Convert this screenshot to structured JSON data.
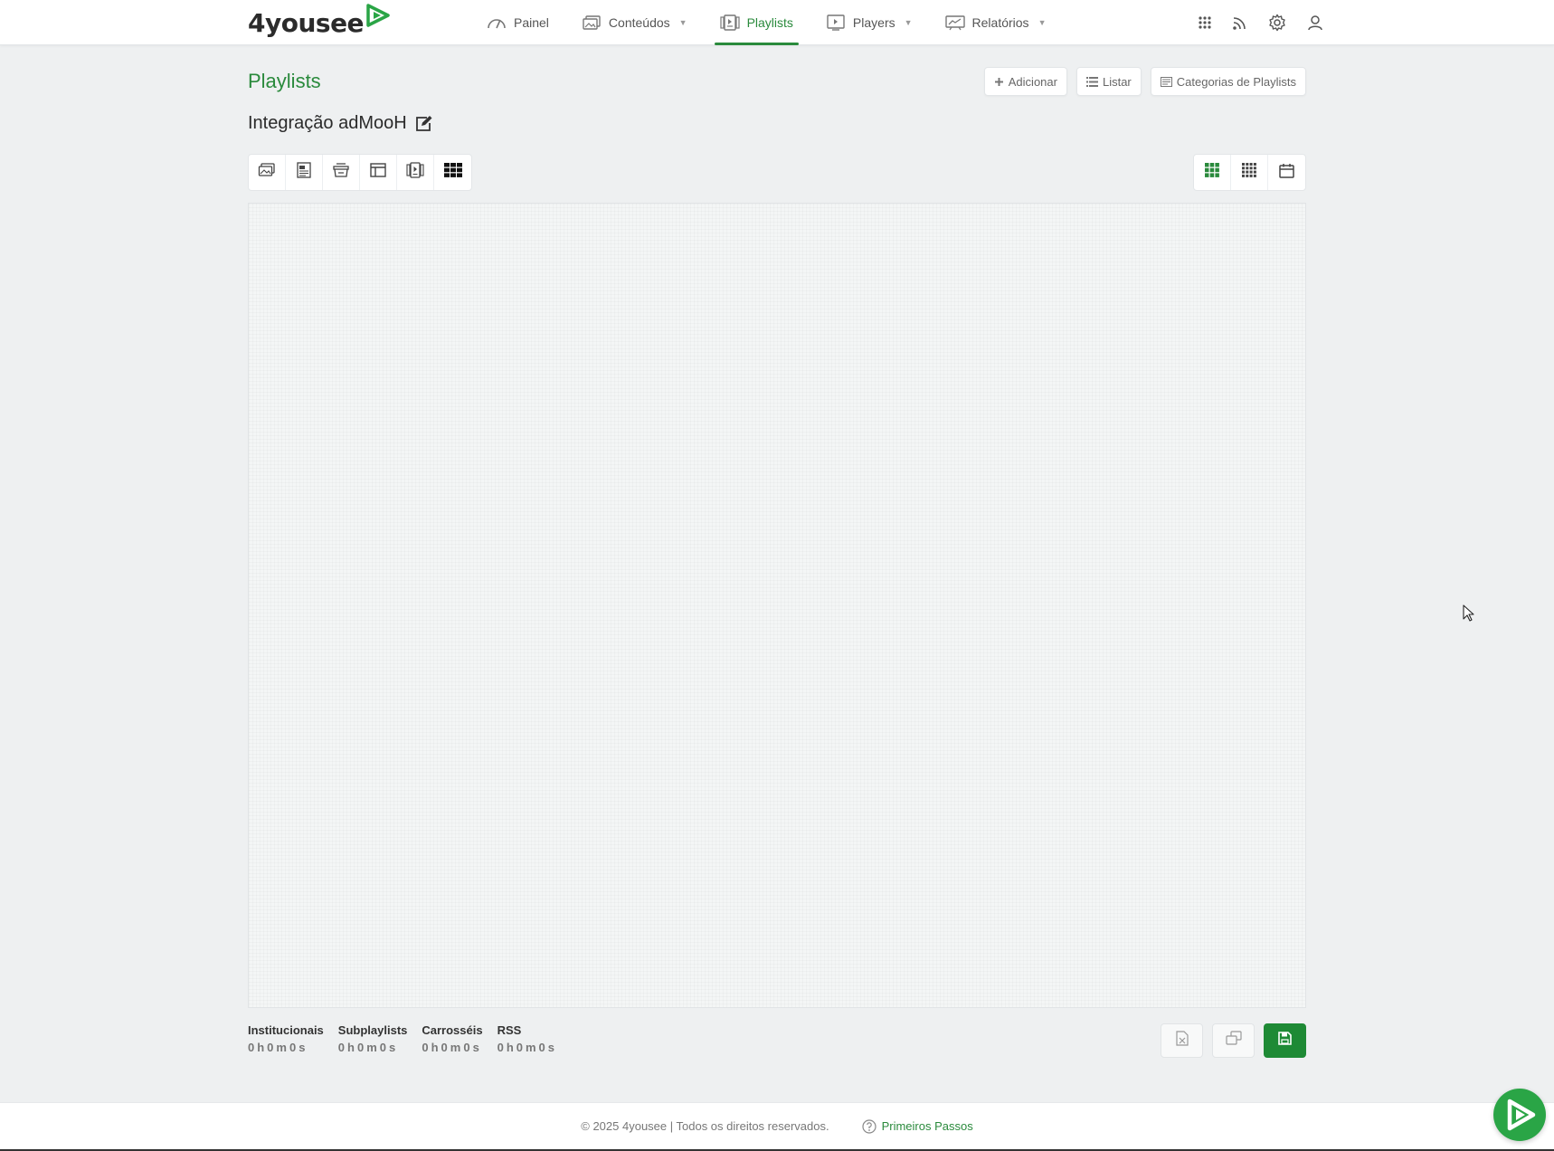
{
  "brand": {
    "name": "4yousee",
    "accent": "#2a8a3c",
    "mark_color": "#2aa546"
  },
  "nav": {
    "items": [
      {
        "label": "Painel",
        "icon": "gauge-icon",
        "dropdown": false,
        "active": false
      },
      {
        "label": "Conteúdos",
        "icon": "images-icon",
        "dropdown": true,
        "active": false
      },
      {
        "label": "Playlists",
        "icon": "playlist-icon",
        "dropdown": false,
        "active": true
      },
      {
        "label": "Players",
        "icon": "player-screen-icon",
        "dropdown": true,
        "active": false
      },
      {
        "label": "Relatórios",
        "icon": "chart-board-icon",
        "dropdown": true,
        "active": false
      }
    ],
    "right_icons": [
      "apps-grid-icon",
      "rss-icon",
      "gear-icon",
      "user-icon"
    ]
  },
  "header": {
    "title": "Playlists",
    "actions": {
      "add": "Adicionar",
      "list": "Listar",
      "categories": "Categorias de Playlists"
    }
  },
  "playlist": {
    "name": "Integração adMooH"
  },
  "toolbar_left": [
    "content-icon",
    "document-icon",
    "carousel-icon",
    "layout-icon",
    "subplaylist-icon",
    "grid-blocks-icon"
  ],
  "toolbar_right": [
    "grid-large-icon",
    "grid-small-icon",
    "calendar-icon"
  ],
  "summary": [
    {
      "label": "Institucionais",
      "value": "0h0m0s"
    },
    {
      "label": "Subplaylists",
      "value": "0h0m0s"
    },
    {
      "label": "Carrosséis",
      "value": "0h0m0s"
    },
    {
      "label": "RSS",
      "value": "0h0m0s"
    }
  ],
  "bottom_actions": [
    "export-excel-icon",
    "duplicate-icon",
    "save-icon"
  ],
  "footer": {
    "copyright": "© 2025 4yousee | Todos os direitos reservados.",
    "help": "Primeiros Passos"
  }
}
